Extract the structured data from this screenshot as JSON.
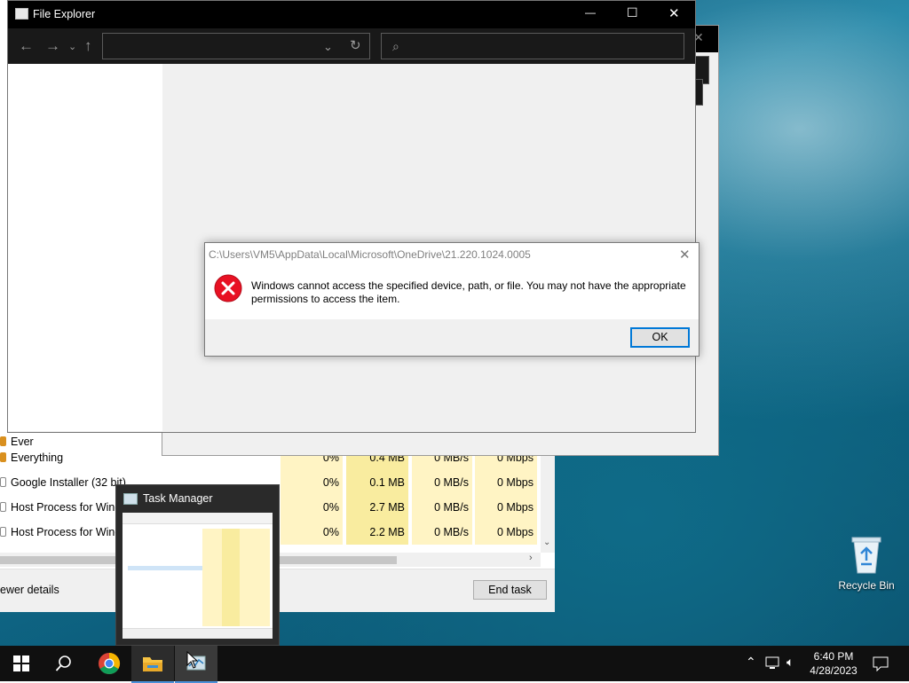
{
  "desktop": {
    "recycle_bin_label": "Recycle Bin"
  },
  "task_manager": {
    "processes": [
      {
        "name": "Ever",
        "icon": "everything-icon",
        "cpu": "",
        "memory": "",
        "disk": "",
        "network": ""
      },
      {
        "name": "Everything",
        "icon": "everything-icon",
        "cpu": "0%",
        "memory": "0.4 MB",
        "disk": "0 MB/s",
        "network": "0 Mbps"
      },
      {
        "name": "Google Installer (32 bit)",
        "icon": "google-installer-icon",
        "cpu": "0%",
        "memory": "0.1 MB",
        "disk": "0 MB/s",
        "network": "0 Mbps"
      },
      {
        "name": "Host Process for Windows Tasks",
        "icon": "host-process-icon",
        "cpu": "0%",
        "memory": "2.7 MB",
        "disk": "0 MB/s",
        "network": "0 Mbps"
      },
      {
        "name": "Host Process for Windo",
        "icon": "host-process-icon",
        "cpu": "0%",
        "memory": "2.2 MB",
        "disk": "0 MB/s",
        "network": "0 Mbps"
      }
    ],
    "fewer_details": "ewer details",
    "end_task": "End task"
  },
  "explorer": {
    "title": "File Explorer",
    "window_controls": {
      "minimize": "—",
      "maximize": "☐",
      "close": "✕"
    }
  },
  "dialog": {
    "title": "C:\\Users\\VM5\\AppData\\Local\\Microsoft\\OneDrive\\21.220.1024.0005",
    "message": "Windows cannot access the specified device, path, or file. You may not have the appropriate permissions to access the item.",
    "ok": "OK",
    "icon": "error-icon",
    "error_color": "#e81123"
  },
  "thumbnail": {
    "title": "Task Manager"
  },
  "taskbar": {
    "time": "6:40 PM",
    "date": "4/28/2023",
    "accent": "#4a90d9"
  }
}
